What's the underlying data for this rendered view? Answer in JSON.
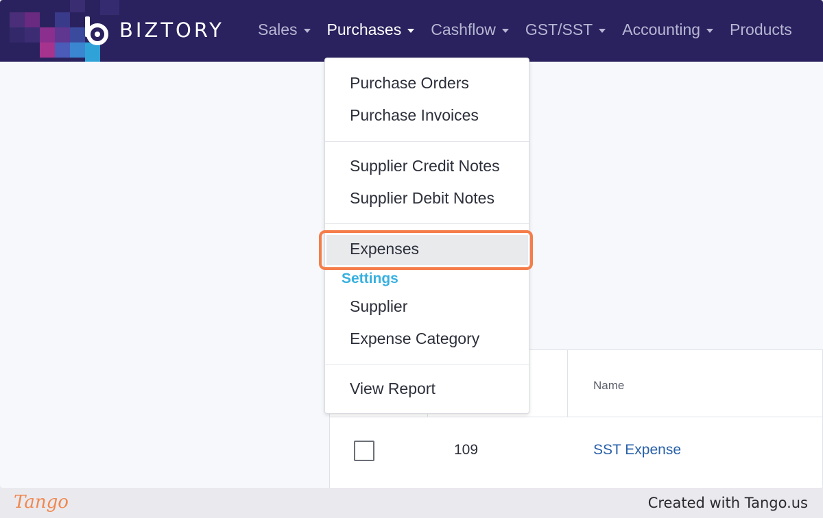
{
  "brand": {
    "name": "BIZTORY",
    "nav_bg": "#2a225e"
  },
  "nav": {
    "items": [
      {
        "label": "Sales",
        "active": false
      },
      {
        "label": "Purchases",
        "active": true
      },
      {
        "label": "Cashflow",
        "active": false
      },
      {
        "label": "GST/SST",
        "active": false
      },
      {
        "label": "Accounting",
        "active": false
      },
      {
        "label": "Products",
        "active": false
      }
    ]
  },
  "dropdown": {
    "items": {
      "purchase_orders": "Purchase Orders",
      "purchase_invoices": "Purchase Invoices",
      "supplier_credit_notes": "Supplier Credit Notes",
      "supplier_debit_notes": "Supplier Debit Notes",
      "expenses": "Expenses",
      "settings_heading": "Settings",
      "supplier": "Supplier",
      "expense_category": "Expense Category",
      "view_report": "View Report"
    },
    "highlighted": "Expenses",
    "highlight_color": "#f57d4a",
    "heading_color": "#37b0e0"
  },
  "table": {
    "columns": {
      "name": "Name"
    },
    "rows": [
      {
        "id": "109",
        "name": "SST Expense"
      }
    ]
  },
  "footer": {
    "logo": "Tango",
    "credit": "Created with Tango.us"
  }
}
